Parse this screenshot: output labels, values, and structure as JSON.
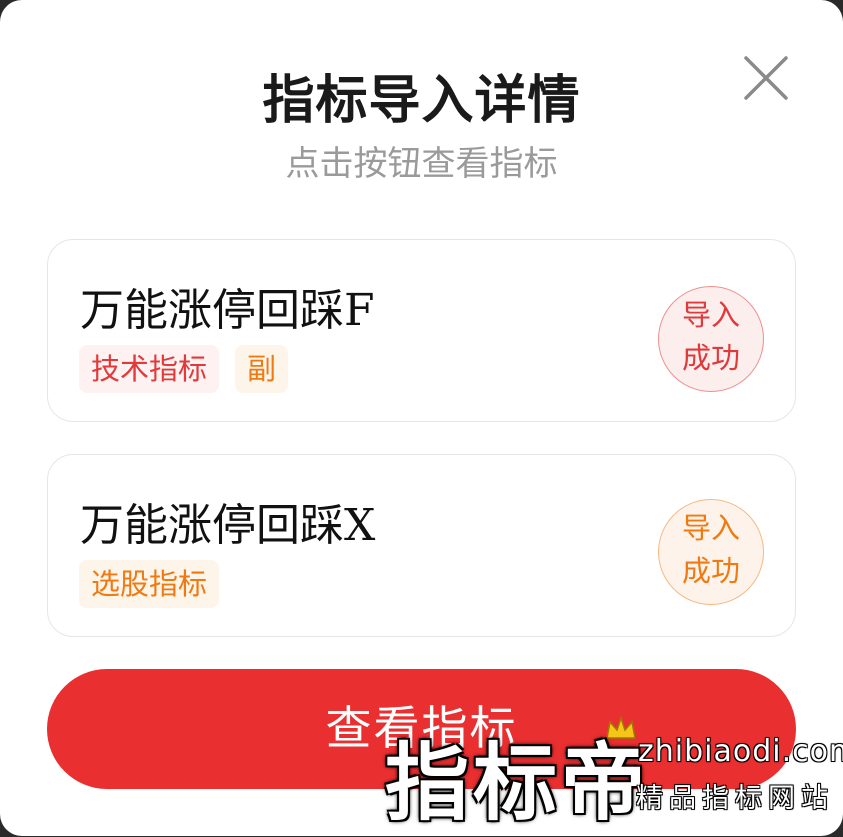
{
  "dialog": {
    "title": "指标导入详情",
    "subtitle": "点击按钮查看指标"
  },
  "close_icon": "close-icon",
  "indicators": [
    {
      "name": "万能涨停回踩F",
      "tags": [
        "技术指标",
        "副"
      ],
      "status_line1": "导入",
      "status_line2": "成功"
    },
    {
      "name": "万能涨停回踩X",
      "tags": [
        "选股指标"
      ],
      "status_line1": "导入",
      "status_line2": "成功"
    }
  ],
  "view_button_label": "查看指标",
  "watermark": {
    "brand": "指标帝",
    "url": "zhibiaodi.com",
    "slogan": "精品指标网站"
  },
  "colors": {
    "accent": "#ea2f31",
    "tag_red": "#e23a3a",
    "tag_orange": "#f07a12"
  }
}
